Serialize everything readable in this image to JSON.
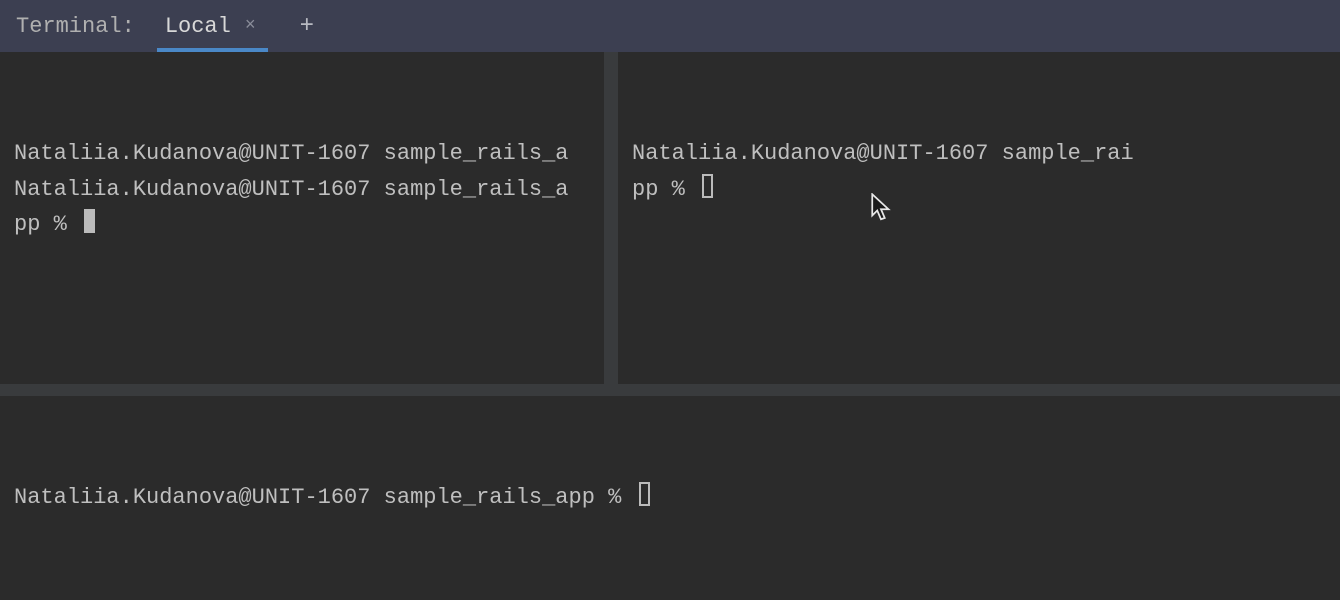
{
  "header": {
    "title": "Terminal:",
    "tab_label": "Local"
  },
  "panes": {
    "left": {
      "line1": "Nataliia.Kudanova@UNIT-1607 sample_rails_a",
      "line2": "Nataliia.Kudanova@UNIT-1607 sample_rails_a",
      "line3": "pp % "
    },
    "right": {
      "line1": "Nataliia.Kudanova@UNIT-1607 sample_rai",
      "line2": "pp % "
    },
    "bottom": {
      "line1": "Nataliia.Kudanova@UNIT-1607 sample_rails_app % "
    }
  }
}
